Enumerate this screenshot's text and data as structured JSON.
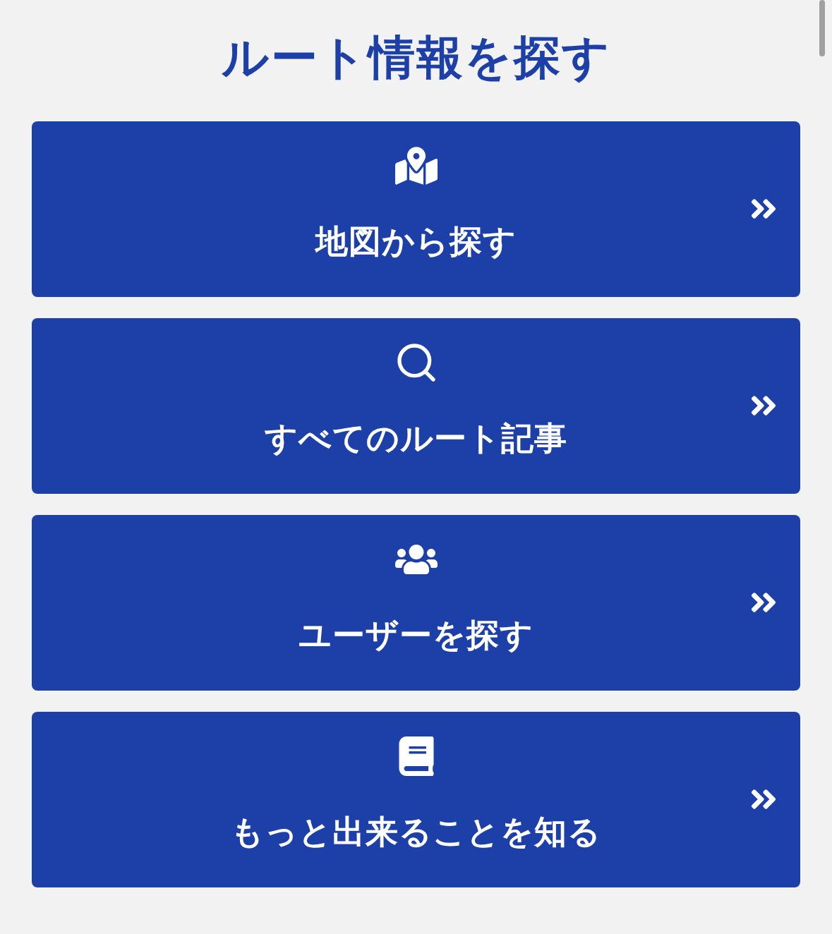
{
  "title": "ルート情報を探す",
  "items": [
    {
      "kind": "map",
      "label": "地図から探す"
    },
    {
      "kind": "search",
      "label": "すべてのルート記事"
    },
    {
      "kind": "users",
      "label": "ユーザーを探す"
    },
    {
      "kind": "book",
      "label": "もっと出来ることを知る"
    }
  ]
}
